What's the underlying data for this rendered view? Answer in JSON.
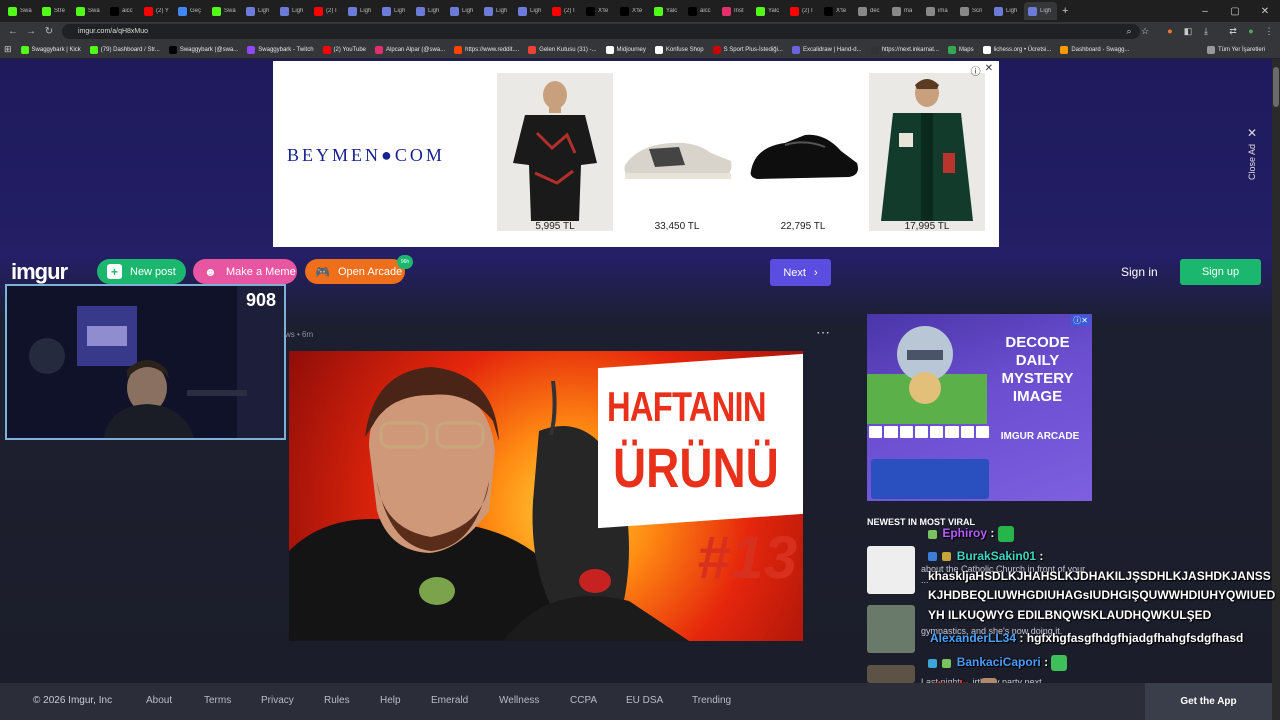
{
  "browser": {
    "tabs": [
      {
        "title": "Swa",
        "color": "#53fc18"
      },
      {
        "title": "Stre",
        "color": "#53fc18"
      },
      {
        "title": "Swa",
        "color": "#53fc18"
      },
      {
        "title": "aicc",
        "color": "#000000"
      },
      {
        "title": "(2) Y",
        "color": "#ff0000"
      },
      {
        "title": "Geç",
        "color": "#4285f4"
      },
      {
        "title": "Swa",
        "color": "#53fc18"
      },
      {
        "title": "Ligh",
        "color": "#6d7bd8"
      },
      {
        "title": "Ligh",
        "color": "#6d7bd8"
      },
      {
        "title": "(2) I",
        "color": "#ff0000"
      },
      {
        "title": "Ligh",
        "color": "#6d7bd8"
      },
      {
        "title": "Ligh",
        "color": "#6d7bd8"
      },
      {
        "title": "Ligh",
        "color": "#6d7bd8"
      },
      {
        "title": "Ligh",
        "color": "#6d7bd8"
      },
      {
        "title": "Ligh",
        "color": "#6d7bd8"
      },
      {
        "title": "Ligh",
        "color": "#6d7bd8"
      },
      {
        "title": "(2) I",
        "color": "#ff0000"
      },
      {
        "title": "X'te",
        "color": "#000000"
      },
      {
        "title": "X'te",
        "color": "#000000"
      },
      {
        "title": "Yalc",
        "color": "#53fc18"
      },
      {
        "title": "aicc",
        "color": "#000000"
      },
      {
        "title": "Inst",
        "color": "#e1306c"
      },
      {
        "title": "Yalc",
        "color": "#53fc18"
      },
      {
        "title": "(2) I",
        "color": "#ff0000"
      },
      {
        "title": "X'te",
        "color": "#000000"
      },
      {
        "title": "dec",
        "color": "#888888"
      },
      {
        "title": "ma",
        "color": "#888888"
      },
      {
        "title": "ima",
        "color": "#888888"
      },
      {
        "title": "Scri",
        "color": "#888888"
      },
      {
        "title": "Ligh",
        "color": "#6d7bd8"
      },
      {
        "title": "Ligh",
        "color": "#6d7bd8"
      }
    ],
    "url": "imgur.com/a/qH8xMuo",
    "bookmarks": [
      {
        "label": "Swaggybark | Kick",
        "color": "#53fc18"
      },
      {
        "label": "(79) Dashboard / Str...",
        "color": "#53fc18"
      },
      {
        "label": "Swaggybark (@swa...",
        "color": "#000000"
      },
      {
        "label": "Swaggybark - Twitch",
        "color": "#9146ff"
      },
      {
        "label": "(2) YouTube",
        "color": "#ff0000"
      },
      {
        "label": "Alpcan Alpar (@swa...",
        "color": "#e1306c"
      },
      {
        "label": "https://www.reddit....",
        "color": "#ff4500"
      },
      {
        "label": "Gelen Kutusu (31) -...",
        "color": "#ea4335"
      },
      {
        "label": "Midjourney",
        "color": "#ffffff"
      },
      {
        "label": "Konfuse Shop",
        "color": "#ffffff"
      },
      {
        "label": "S Sport Plus-İstediği...",
        "color": "#cc0000"
      },
      {
        "label": "Excalidraw | Hand-d...",
        "color": "#6965db"
      },
      {
        "label": "https://next.inkarnat...",
        "color": "#333333"
      },
      {
        "label": "Maps",
        "color": "#34a853"
      },
      {
        "label": "lichess.org • Ücretsi...",
        "color": "#ffffff"
      },
      {
        "label": "Dashboard - Swagg...",
        "color": "#ff9900"
      }
    ],
    "all_bookmarks": "Tüm Yer İşaretleri"
  },
  "ad": {
    "brand": "BEYMEN●COM",
    "products": [
      {
        "price": "5,995 TL"
      },
      {
        "price": "33,450 TL"
      },
      {
        "price": "22,795 TL"
      },
      {
        "price": "17,995 TL"
      }
    ],
    "close_label": "Close Ad"
  },
  "header": {
    "logo": "imgur",
    "new_post": "New post",
    "make_meme": "Make a Meme",
    "open_arcade": "Open Arcade",
    "arcade_badge": "96h",
    "next": "Next",
    "sign_in": "Sign in",
    "sign_up": "Sign up"
  },
  "webcam": {
    "viewer_count": "908"
  },
  "post": {
    "meta": "ws • 6m",
    "thumbnail": {
      "line1": "HAFTANIN",
      "line2": "ÜRÜNÜ",
      "number": "#13"
    }
  },
  "sidebar": {
    "ad": {
      "headline": "DECODE DAILY MYSTERY IMAGE",
      "sub": "IMGUR ARCADE"
    },
    "newest_title": "NEWEST IN MOST VIRAL",
    "items": [
      {
        "text": "about the Catholic Church in front of your ..."
      },
      {
        "text": "gymnastics, and she's now doing it."
      },
      {
        "text": "Last night ... irthday party next"
      }
    ]
  },
  "chat": [
    {
      "user": "Ephiroy",
      "message": "",
      "user_color": "#b65cff"
    },
    {
      "user": "BurakSakin01",
      "message": "",
      "user_color": "#3dd6c3"
    },
    {
      "user": "",
      "message": "khaskljaHSDLKJHAHSLKJDHAKILJŞSDHLKJASHDKJANSS",
      "user_color": "#ffffff"
    },
    {
      "user": "",
      "message": "KJHDBEQLIUWHGDIUHAGsIUDHGIŞQUWWHDIUHYQWIUED",
      "user_color": "#ffffff"
    },
    {
      "user": "",
      "message": "YH ILKUQWYG EDILBNQWSKLAUDHQWKULŞED",
      "user_color": "#ffffff"
    },
    {
      "user": "AlexanderLL34",
      "message": "hgfxhgfasgfhdgfhjadgfhahgfsdgfhasd",
      "user_color": "#4aa3ff"
    },
    {
      "user": "BankaciCapori",
      "message": "",
      "user_color": "#4a9bff"
    },
    {
      "user": "gtmpln",
      "message": "",
      "user_color": "#ff3b3b"
    }
  ],
  "footer": {
    "copyright": "© 2026 Imgur, Inc",
    "links": [
      "About",
      "Terms",
      "Privacy",
      "Rules",
      "Help",
      "Emerald",
      "Wellness",
      "CCPA",
      "EU DSA",
      "Trending"
    ],
    "get_app": "Get the App"
  }
}
